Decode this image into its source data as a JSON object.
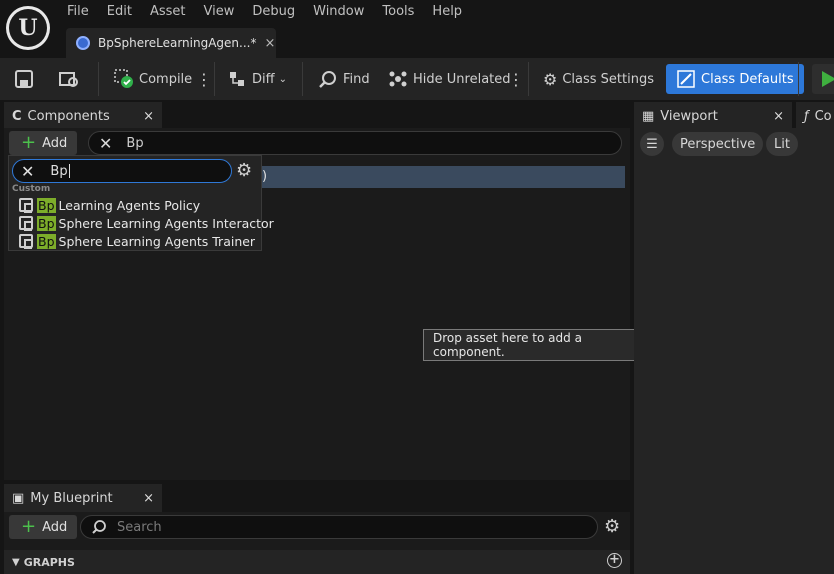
{
  "menu": [
    "File",
    "Edit",
    "Asset",
    "View",
    "Debug",
    "Window",
    "Tools",
    "Help"
  ],
  "doc_tab": {
    "title": "BpSphereLearningAgen...*",
    "close": "×"
  },
  "toolbar": {
    "compile": "Compile",
    "diff": "Diff",
    "find": "Find",
    "hide_unrelated": "Hide Unrelated",
    "class_settings": "Class Settings",
    "class_defaults": "Class Defaults"
  },
  "components": {
    "tab_label": "Components",
    "close": "×",
    "add_label": "Add",
    "search_value": "Bp",
    "selected_row_fragment": ")",
    "tooltip": "Drop asset here to add a component."
  },
  "add_dropdown": {
    "search_value": "Bp",
    "category": "Custom",
    "items": [
      {
        "highlight": "Bp",
        "label": "Learning Agents Policy"
      },
      {
        "highlight": "Bp",
        "label": "Sphere Learning Agents Interactor"
      },
      {
        "highlight": "Bp",
        "label": "Sphere Learning Agents Trainer"
      }
    ]
  },
  "my_blueprint": {
    "tab_label": "My Blueprint",
    "close": "×",
    "add_label": "Add",
    "search_placeholder": "Search",
    "graphs_label": "GRAPHS"
  },
  "viewport": {
    "tab_label": "Viewport",
    "close": "×",
    "perspective": "Perspective",
    "lit": "Lit",
    "next_tab_fragment": "Co"
  },
  "colors": {
    "accent": "#2d78d9",
    "highlight": "#7dad2a",
    "add_green": "#4cc14c"
  }
}
